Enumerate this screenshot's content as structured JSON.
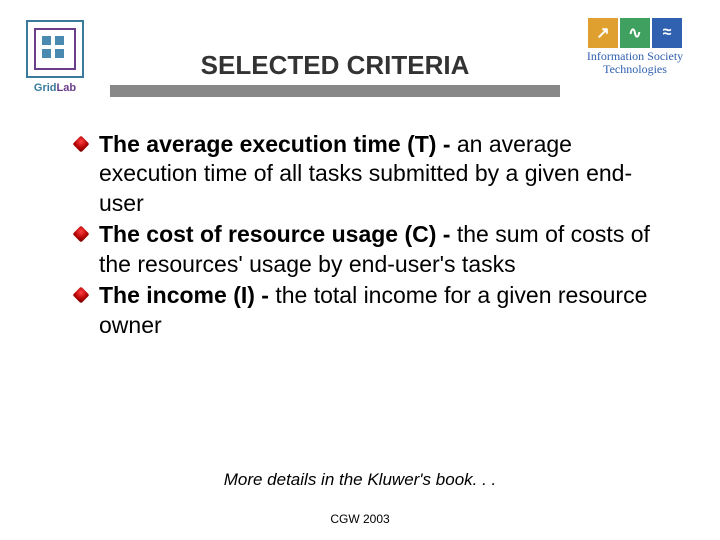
{
  "header": {
    "title": "SELECTED CRITERIA",
    "left_logo": {
      "prefix": "Grid",
      "suffix": "Lab"
    },
    "right_logo": {
      "line1": "Information Society",
      "line2": "Technologies"
    }
  },
  "bullets": [
    {
      "bold": "The average execution time (T) -",
      "rest": "    an average execution time of all tasks submitted by a given end-user"
    },
    {
      "bold": "The cost of resource usage (C) -",
      "rest": "   the sum of costs of the resources' usage by end-user's tasks"
    },
    {
      "bold": "The income (I) -",
      "rest": " the total income for a given resource owner"
    }
  ],
  "footer_note": "More details in the Kluwer's book. . .",
  "footer": "CGW 2003"
}
